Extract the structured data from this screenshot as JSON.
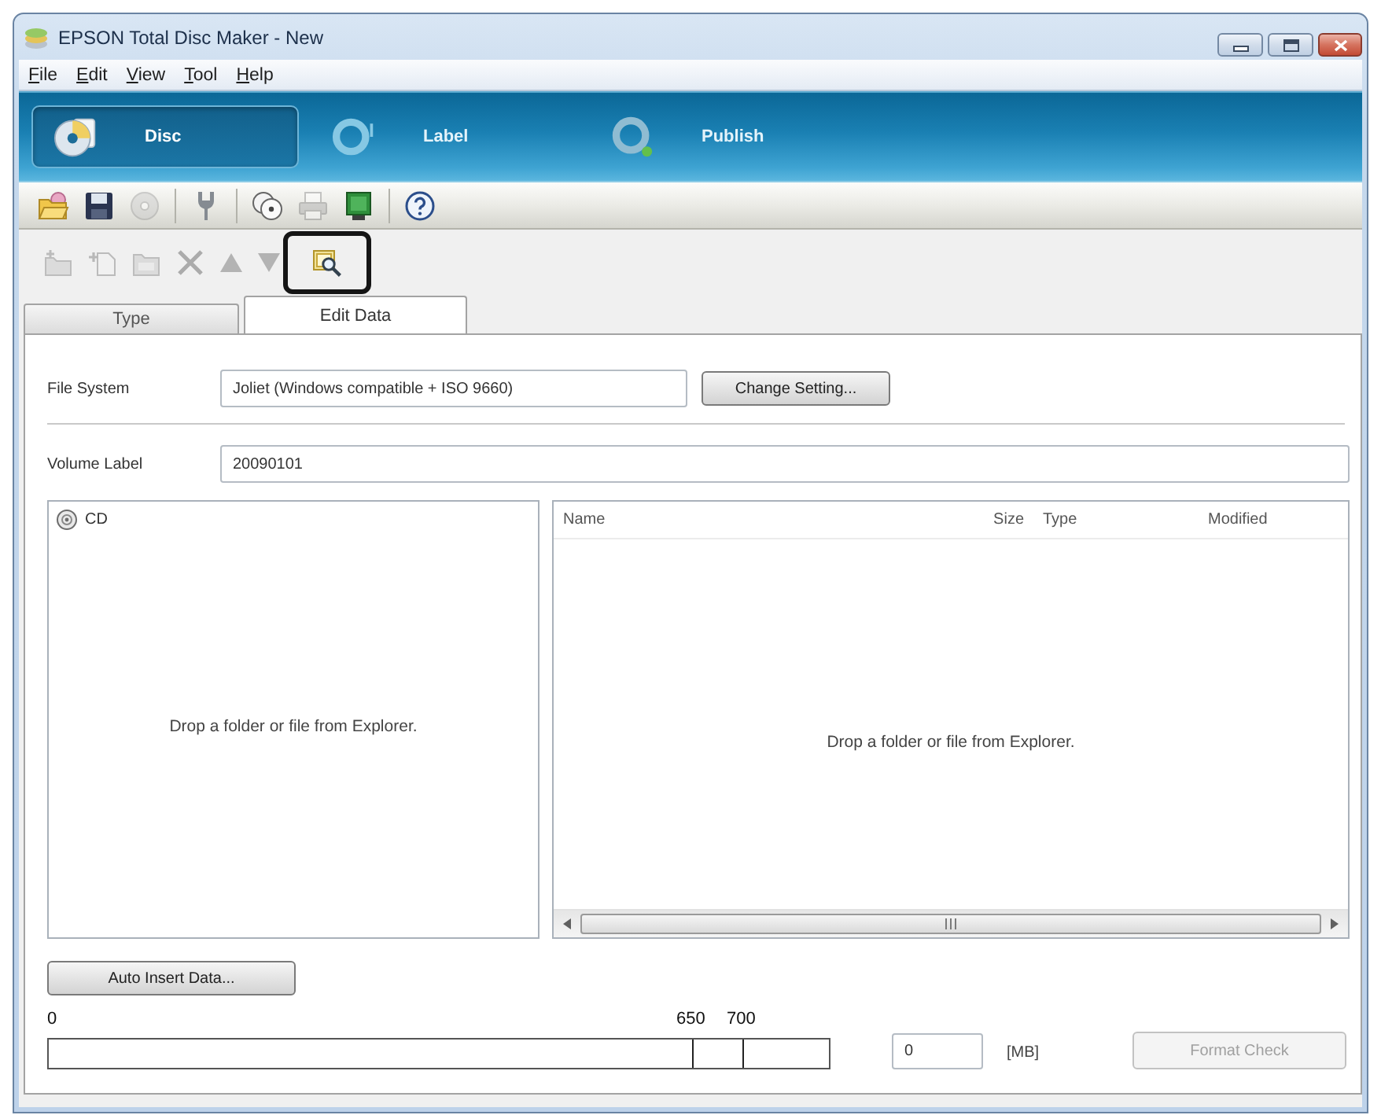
{
  "window": {
    "title": "EPSON Total Disc Maker - New"
  },
  "menu": [
    "File",
    "Edit",
    "View",
    "Tool",
    "Help"
  ],
  "modes": [
    {
      "kind": "disc",
      "label": "Disc",
      "selected": true
    },
    {
      "kind": "label",
      "label": "Label",
      "selected": false
    },
    {
      "kind": "publish",
      "label": "Publish",
      "selected": false
    }
  ],
  "main_toolbar": [
    {
      "buttons": [
        {
          "kind": "open",
          "disabled": false
        },
        {
          "kind": "save",
          "disabled": false
        },
        {
          "kind": "burn",
          "disabled": true
        }
      ]
    },
    {
      "buttons": [
        {
          "kind": "tools",
          "disabled": false
        }
      ]
    },
    {
      "buttons": [
        {
          "kind": "copies",
          "disabled": false
        },
        {
          "kind": "print",
          "disabled": true
        },
        {
          "kind": "monitor",
          "disabled": false
        }
      ]
    },
    {
      "buttons": [
        {
          "kind": "help",
          "disabled": false
        }
      ]
    }
  ],
  "edit_toolbar": [
    {
      "kind": "new_folder",
      "disabled": true,
      "highlighted": false
    },
    {
      "kind": "add",
      "disabled": true,
      "highlighted": false
    },
    {
      "kind": "folder",
      "disabled": true,
      "highlighted": false
    },
    {
      "kind": "delete",
      "disabled": true,
      "highlighted": false
    },
    {
      "kind": "up",
      "disabled": true,
      "highlighted": false
    },
    {
      "kind": "down",
      "disabled": true,
      "highlighted": false
    },
    {
      "kind": "preview",
      "disabled": false,
      "highlighted": true
    }
  ],
  "tabs": [
    {
      "label": "Type",
      "selected": false
    },
    {
      "label": "Edit Data",
      "selected": true
    }
  ],
  "file_system": {
    "label": "File System",
    "value": "Joliet (Windows compatible + ISO 9660)",
    "button": "Change Setting..."
  },
  "volume_label": {
    "label": "Volume Label",
    "value": "20090101"
  },
  "tree": {
    "items": [
      {
        "label": "CD",
        "selected": false
      }
    ],
    "hint": "Drop a folder or file from Explorer."
  },
  "file_list": {
    "columns": [
      "Name",
      "Size",
      "Type",
      "Modified"
    ],
    "hint": "Drop a folder or file from Explorer."
  },
  "auto_insert_button": "Auto Insert Data...",
  "capacity": {
    "scale": [
      "0",
      "650",
      "700"
    ],
    "size": "0",
    "unit": "[MB]"
  },
  "format_check": {
    "label": "Format Check",
    "disabled": true
  }
}
